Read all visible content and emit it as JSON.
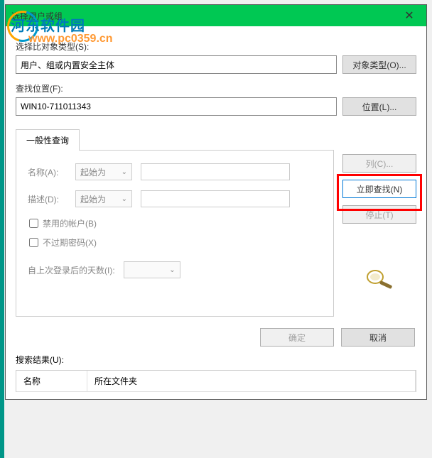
{
  "watermark": {
    "site_name": "河东软件园",
    "url": "www.pc0359.cn"
  },
  "titlebar": {
    "title": "选择用户或组",
    "close": "✕"
  },
  "object_type": {
    "label": "选择比对象类型(S):",
    "value": "用户、组或内置安全主体",
    "button": "对象类型(O)..."
  },
  "location": {
    "label": "查找位置(F):",
    "value": "WIN10-711011343",
    "button": "位置(L)..."
  },
  "tabs": {
    "general": "一般性查询"
  },
  "form": {
    "name_label": "名称(A):",
    "name_mode": "起始为",
    "desc_label": "描述(D):",
    "desc_mode": "起始为",
    "disabled_accounts": "禁用的帐户(B)",
    "non_expiring": "不过期密码(X)",
    "days_label": "自上次登录后的天数(I):"
  },
  "side_buttons": {
    "columns": "列(C)...",
    "find_now": "立即查找(N)",
    "stop": "停止(T)"
  },
  "actions": {
    "ok": "确定",
    "cancel": "取消"
  },
  "results": {
    "label": "搜索结果(U):",
    "col_name": "名称",
    "col_folder": "所在文件夹"
  }
}
